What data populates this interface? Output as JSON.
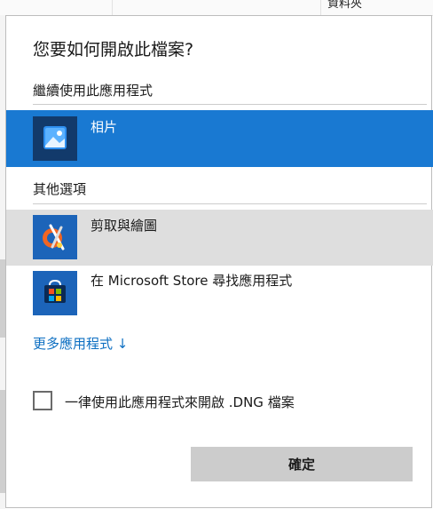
{
  "background": {
    "column_header": "資料夾"
  },
  "dialog": {
    "title": "您要如何開啟此檔案?",
    "current_section_label": "繼續使用此應用程式",
    "current_app": {
      "name": "相片",
      "icon": "photos-icon"
    },
    "other_section_label": "其他選項",
    "other_apps": [
      {
        "name": "剪取與繪圖",
        "icon": "snip-sketch-icon"
      },
      {
        "name": "在 Microsoft Store 尋找應用程式",
        "icon": "store-icon"
      }
    ],
    "more_apps_link": "更多應用程式 ↓",
    "always_use_checkbox_label": "一律使用此應用程式來開啟 .DNG 檔案",
    "always_use_checked": false,
    "ok_button": "確定"
  },
  "colors": {
    "selected_row": "#1979d2",
    "hover_row": "#dedede",
    "link": "#0d6fc2",
    "button": "#cccccc"
  }
}
